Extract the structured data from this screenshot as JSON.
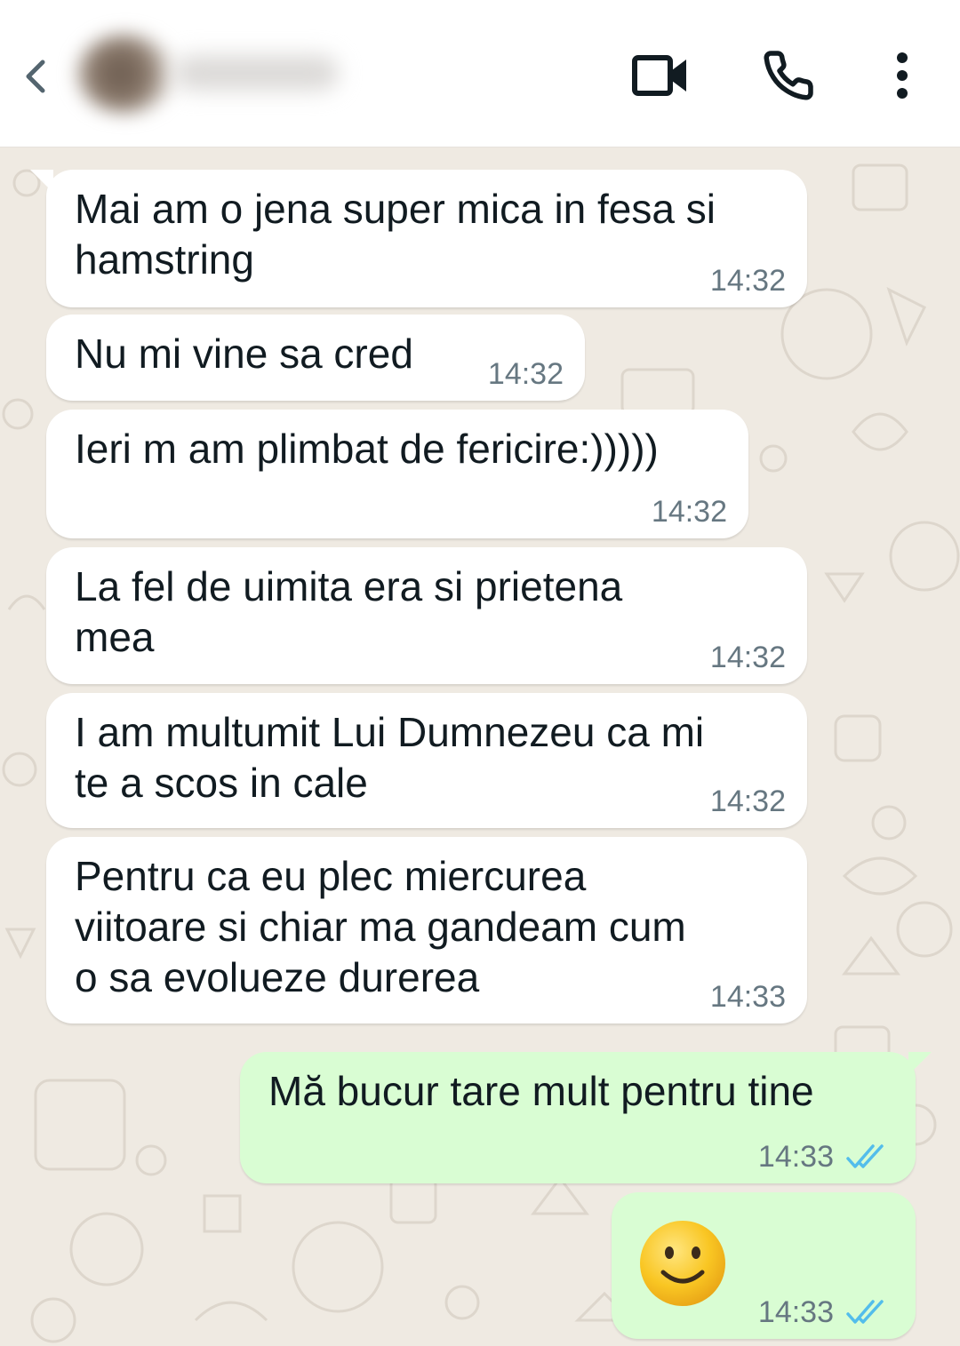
{
  "header": {
    "back_icon": "chevron-left-icon",
    "video_icon": "video-camera-icon",
    "call_icon": "phone-icon",
    "more_icon": "more-vertical-icon"
  },
  "messages": [
    {
      "direction": "in",
      "text": "Mai am o jena super mica in fesa si\nhamstring",
      "time": "14:32"
    },
    {
      "direction": "in",
      "text": "Nu mi vine sa cred",
      "time": "14:32"
    },
    {
      "direction": "in",
      "text": "Ieri m am plimbat de fericire:)))))",
      "time": "14:32"
    },
    {
      "direction": "in",
      "text": "La fel de uimita era si prietena\nmea",
      "time": "14:32"
    },
    {
      "direction": "in",
      "text": "I am multumit Lui Dumnezeu ca mi\nte a scos in cale",
      "time": "14:32"
    },
    {
      "direction": "in",
      "text": "Pentru ca eu plec miercurea\nviitoare si chiar ma gandeam cum\no sa evolueze durerea",
      "time": "14:33"
    },
    {
      "direction": "out",
      "text": "Mă bucur tare mult pentru tine",
      "time": "14:33",
      "status": "read"
    },
    {
      "direction": "out",
      "emoji": "slightly-smiling-face",
      "time": "14:33",
      "status": "read"
    }
  ],
  "colors": {
    "incoming_bubble": "#ffffff",
    "outgoing_bubble": "#d9fdd3",
    "chat_background": "#efeae2",
    "read_ticks": "#53bdeb"
  }
}
